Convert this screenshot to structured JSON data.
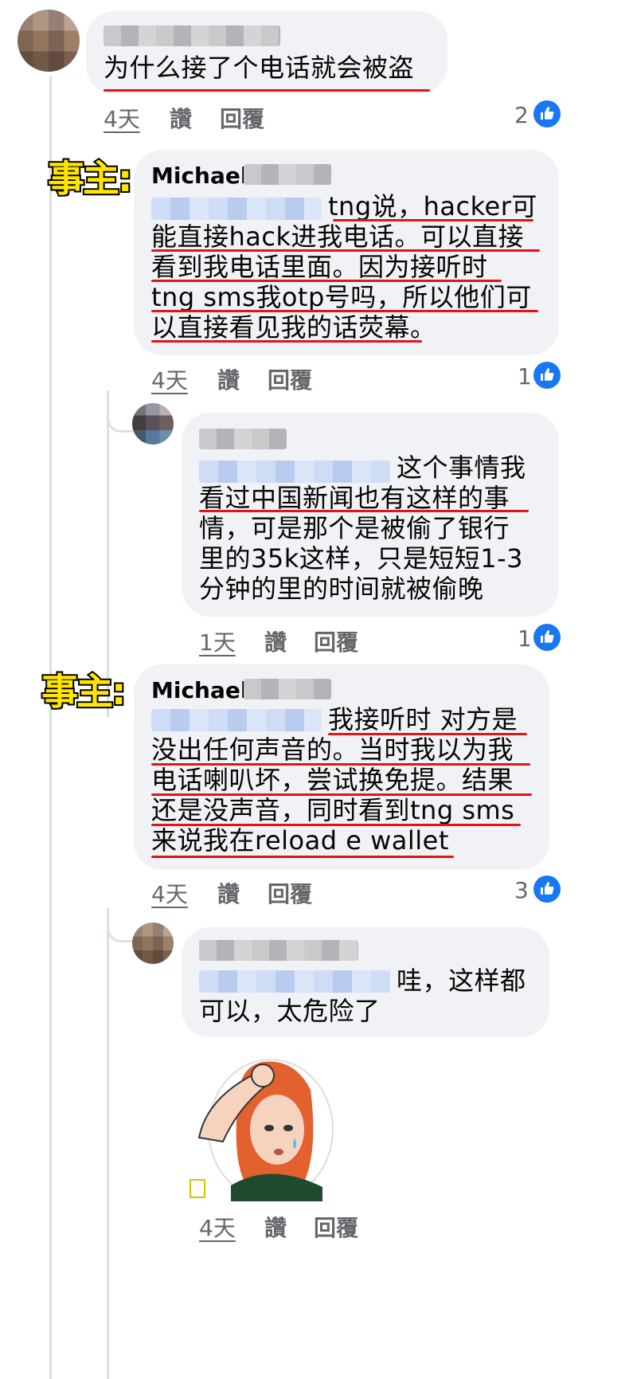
{
  "label_owner": "事主:",
  "comments": [
    {
      "author": "",
      "lines": [
        "为什么接了个电话就会被盗"
      ],
      "time": "4天",
      "like": "讚",
      "reply": "回覆",
      "reactions": "2"
    },
    {
      "author": "Michael",
      "lines": [
        "tng说，hacker可",
        "能直接hack进我电话。可以直接",
        "看到我电话里面。因为接听时",
        "tng sms我otp号吗，所以他们可",
        "以直接看见我的话荧幕。"
      ],
      "time": "4天",
      "like": "讚",
      "reply": "回覆",
      "reactions": "1"
    },
    {
      "author": "",
      "lines": [
        "这个事情我",
        "看过中国新闻也有这样的事",
        "情，可是那个是被偷了银行",
        "里的35k这样，只是短短1-3",
        "分钟的里的时间就被偷晚"
      ],
      "time": "1天",
      "like": "讚",
      "reply": "回覆",
      "reactions": "1"
    },
    {
      "author": "Michael",
      "lines": [
        "我接听时 对方是",
        "没出任何声音的。当时我以为我",
        "电话喇叭坏，尝试换免提。结果",
        "还是没声音，同时看到tng sms",
        "来说我在reload e wallet"
      ],
      "time": "4天",
      "like": "讚",
      "reply": "回覆",
      "reactions": "3"
    },
    {
      "author": "",
      "lines": [
        "哇，这样都",
        "可以，太危险了"
      ],
      "time": "4天",
      "like": "讚",
      "reply": "回覆",
      "reactions": ""
    }
  ],
  "colors": {
    "accent": "#1877f2",
    "underline": "#e0151c",
    "bubble": "#f0f2f5",
    "owner_label": "#ffe600"
  }
}
